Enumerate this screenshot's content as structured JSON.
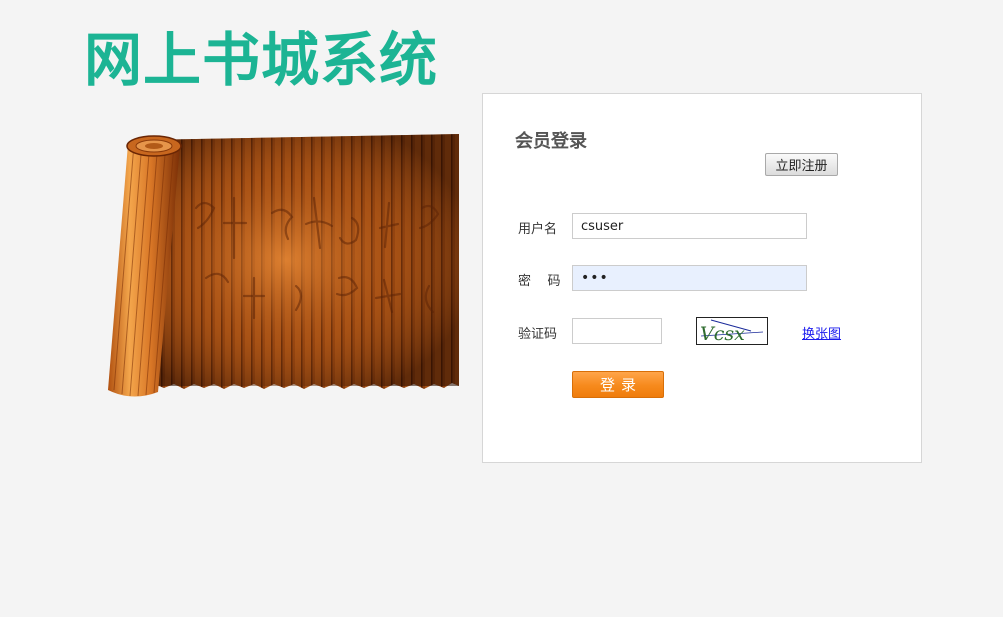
{
  "header": {
    "site_title": "网上书城系统"
  },
  "login": {
    "title": "会员登录",
    "register_label": "立即注册",
    "username_label": "用户名",
    "username_value": "csuser",
    "password_label": "密    码",
    "password_value": "•••",
    "captcha_label": "验证码",
    "captcha_value": "",
    "captcha_text": "Vcsx",
    "refresh_label": "换张图",
    "submit_label": "登录"
  },
  "colors": {
    "title": "#1cb494",
    "button_orange": "#f68a1c",
    "link": "#1a1aee"
  }
}
